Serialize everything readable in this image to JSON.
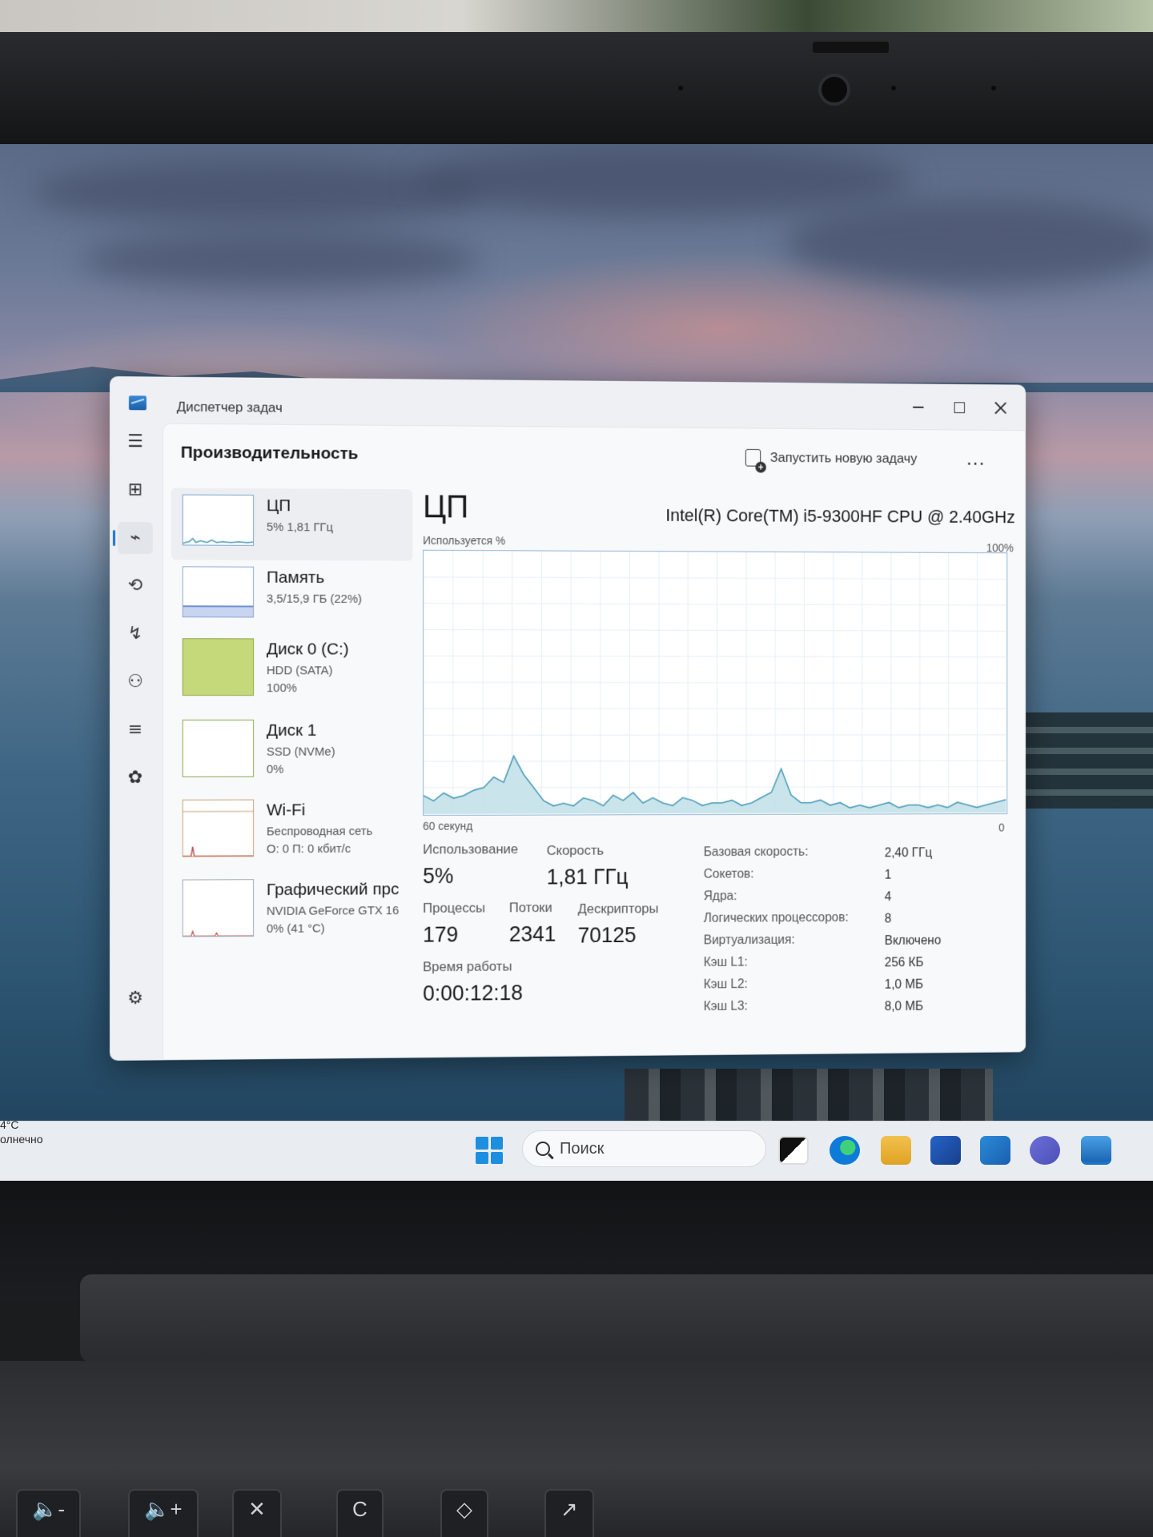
{
  "window": {
    "title": "Диспетчер задач",
    "page_title": "Производительность",
    "run_task_label": "Запустить новую задачу",
    "more_label": "..."
  },
  "nav": [
    "menu-icon",
    "processes-icon",
    "performance-icon",
    "app-history-icon",
    "startup-apps-icon",
    "users-icon",
    "details-icon",
    "services-icon",
    "settings-icon"
  ],
  "devices": [
    {
      "name": "ЦП",
      "line1": "5% 1,81 ГГц",
      "line2": "",
      "selected": true
    },
    {
      "name": "Память",
      "line1": "3,5/15,9 ГБ (22%)",
      "line2": "",
      "selected": false
    },
    {
      "name": "Диск 0 (C:)",
      "line1": "HDD (SATA)",
      "line2": "100%",
      "selected": false
    },
    {
      "name": "Диск 1",
      "line1": "SSD (NVMe)",
      "line2": "0%",
      "selected": false
    },
    {
      "name": "Wi-Fi",
      "line1": "Беспроводная сеть",
      "line2": "О: 0 П: 0 кбит/с",
      "selected": false
    },
    {
      "name": "Графический прс",
      "line1": "NVIDIA GeForce GTX 16",
      "line2": "0% (41 °C)",
      "selected": false
    }
  ],
  "cpu": {
    "title": "ЦП",
    "model": "Intel(R) Core(TM) i5-9300HF CPU @ 2.40GHz",
    "axis_top_label": "Используется %",
    "axis_top_max": "100%",
    "axis_bottom_label": "60 секунд",
    "axis_bottom_min": "0",
    "usage_label": "Использование",
    "usage_value": "5%",
    "speed_label": "Скорость",
    "speed_value": "1,81 ГГц",
    "processes_label": "Процессы",
    "processes_value": "179",
    "threads_label": "Потоки",
    "threads_value": "2341",
    "handles_label": "Дескрипторы",
    "handles_value": "70125",
    "uptime_label": "Время работы",
    "uptime_value": "0:00:12:18",
    "specs": [
      {
        "label": "Базовая скорость:",
        "value": "2,40 ГГц"
      },
      {
        "label": "Сокетов:",
        "value": "1"
      },
      {
        "label": "Ядра:",
        "value": "4"
      },
      {
        "label": "Логических процессоров:",
        "value": "8"
      },
      {
        "label": "Виртуализация:",
        "value": "Включено"
      },
      {
        "label": "Кэш L1:",
        "value": "256 КБ"
      },
      {
        "label": "Кэш L2:",
        "value": "1,0 МБ"
      },
      {
        "label": "Кэш L3:",
        "value": "8,0 МБ"
      }
    ]
  },
  "chart_data": {
    "type": "area",
    "ylim": [
      0,
      100
    ],
    "values": [
      7,
      5,
      8,
      6,
      7,
      9,
      10,
      14,
      12,
      22,
      15,
      10,
      5,
      3,
      4,
      3,
      6,
      5,
      3,
      7,
      5,
      8,
      4,
      6,
      4,
      3,
      6,
      5,
      3,
      4,
      4,
      5,
      3,
      4,
      6,
      8,
      17,
      7,
      4,
      4,
      5,
      3,
      4,
      2,
      3,
      2,
      3,
      4,
      2,
      3,
      3,
      2,
      3,
      2,
      4,
      3,
      2,
      3,
      4,
      5
    ],
    "colors": {
      "line": "#4a9bb8",
      "fill": "#bfe0e8"
    }
  },
  "taskbar": {
    "weather_temp": "4°C",
    "weather_text": "олнечно",
    "search_placeholder": "Поиск"
  },
  "keyboard": [
    "🔈-",
    "🔈+",
    "✕",
    "C",
    "◇",
    "↗"
  ]
}
